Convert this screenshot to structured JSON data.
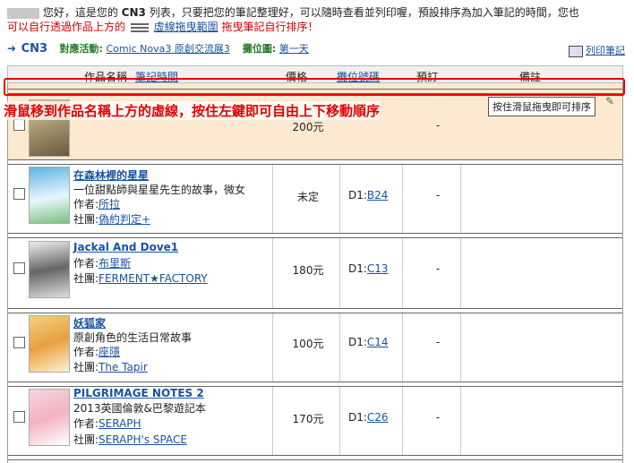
{
  "intro": {
    "line1_a": "您好，這是您的",
    "line1_cn3": "CN3",
    "line1_b": "列表，只要把您的筆記整理好，可以隨時查看並列印喔，預設排序為加入筆記的時間，您也",
    "line2_red1": "可以自行透過作品上方的",
    "line2_link": "虛線拖曳範圍",
    "line2_red2": "拖曳筆記自行排序！"
  },
  "header": {
    "cn3": "CN3",
    "event_label": "對應活動:",
    "event_value": "Comic Nova3 原創交流展3",
    "booth_label": "攤位圖:",
    "booth_value": "第一天",
    "print": "列印筆記"
  },
  "table_head": {
    "name": "作品名稱",
    "time": "筆記時間",
    "price": "價格",
    "loc": "攤位號碼",
    "reserve": "預訂",
    "note": "備註"
  },
  "hint": "滑鼠移到作品名稱上方的虛線，按住左鍵即可自由上下移動順序",
  "tooltip": "按住滑鼠拖曳即可排序",
  "colors": {
    "accent": "#1a52a3",
    "red": "#e60000",
    "highlight_row": "#fde9d0"
  },
  "rows": [
    {
      "title": "",
      "desc": "",
      "author": "",
      "circle": "",
      "price": "200元",
      "loc_prefix": "",
      "loc": "",
      "reserve": "-"
    },
    {
      "title": "在森林裡的星星",
      "desc": "一位甜點師與星星先生的故事，微女",
      "author_label": "作者:",
      "author": "所拉",
      "circle_label": "社團:",
      "circle": "偽約判定+",
      "price": "未定",
      "loc_prefix": "D1:",
      "loc": "B24",
      "reserve": "-"
    },
    {
      "title": "Jackal And Dove1",
      "desc": "",
      "author_label": "作者:",
      "author": "布里斯",
      "circle_label": "社團:",
      "circle": "FERMENT★FACTORY",
      "price": "180元",
      "loc_prefix": "D1:",
      "loc": "C13",
      "reserve": "-"
    },
    {
      "title": "妖狐家",
      "desc": "原創角色的生活日常故事",
      "author_label": "作者:",
      "author": "座隱",
      "circle_label": "社團:",
      "circle": "The Tapir",
      "price": "100元",
      "loc_prefix": "D1:",
      "loc": "C14",
      "reserve": "-"
    },
    {
      "title": "PILGRIMAGE NOTES 2",
      "desc": "2013英國倫敦&巴黎遊記本",
      "author_label": "作者:",
      "author": "SERAPH",
      "circle_label": "社團:",
      "circle": "SERAPH's SPACE",
      "price": "170元",
      "loc_prefix": "D1:",
      "loc": "C26",
      "reserve": "-"
    }
  ]
}
